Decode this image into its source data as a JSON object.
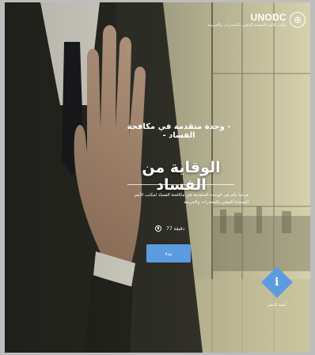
{
  "brand": {
    "name": "UNODC",
    "subtitle": "مكتب الأمم المتحدة المعني بالمخدرات والجريمة",
    "emblem_icon": "un-emblem-icon"
  },
  "hero": {
    "tagline": "- وحدة متقدمة في مكافحة الفساد -",
    "title": "الوقاية من الفساد",
    "description": "مرحبا بكم في الوحدة المتقدمة في مكافحة الفساد لمكتب الأمم المتحدة المعني بالمخدرات والجريمة",
    "duration": "دقيقة 77",
    "duration_icon": "clock-icon",
    "start_label": "بدء"
  },
  "help": {
    "icon": "info-icon",
    "glyph": "i",
    "label": "كيفية التنقل"
  },
  "colors": {
    "accent": "#5b9be0",
    "text": "#ffffff",
    "page_bg": "#bdbdbd"
  }
}
